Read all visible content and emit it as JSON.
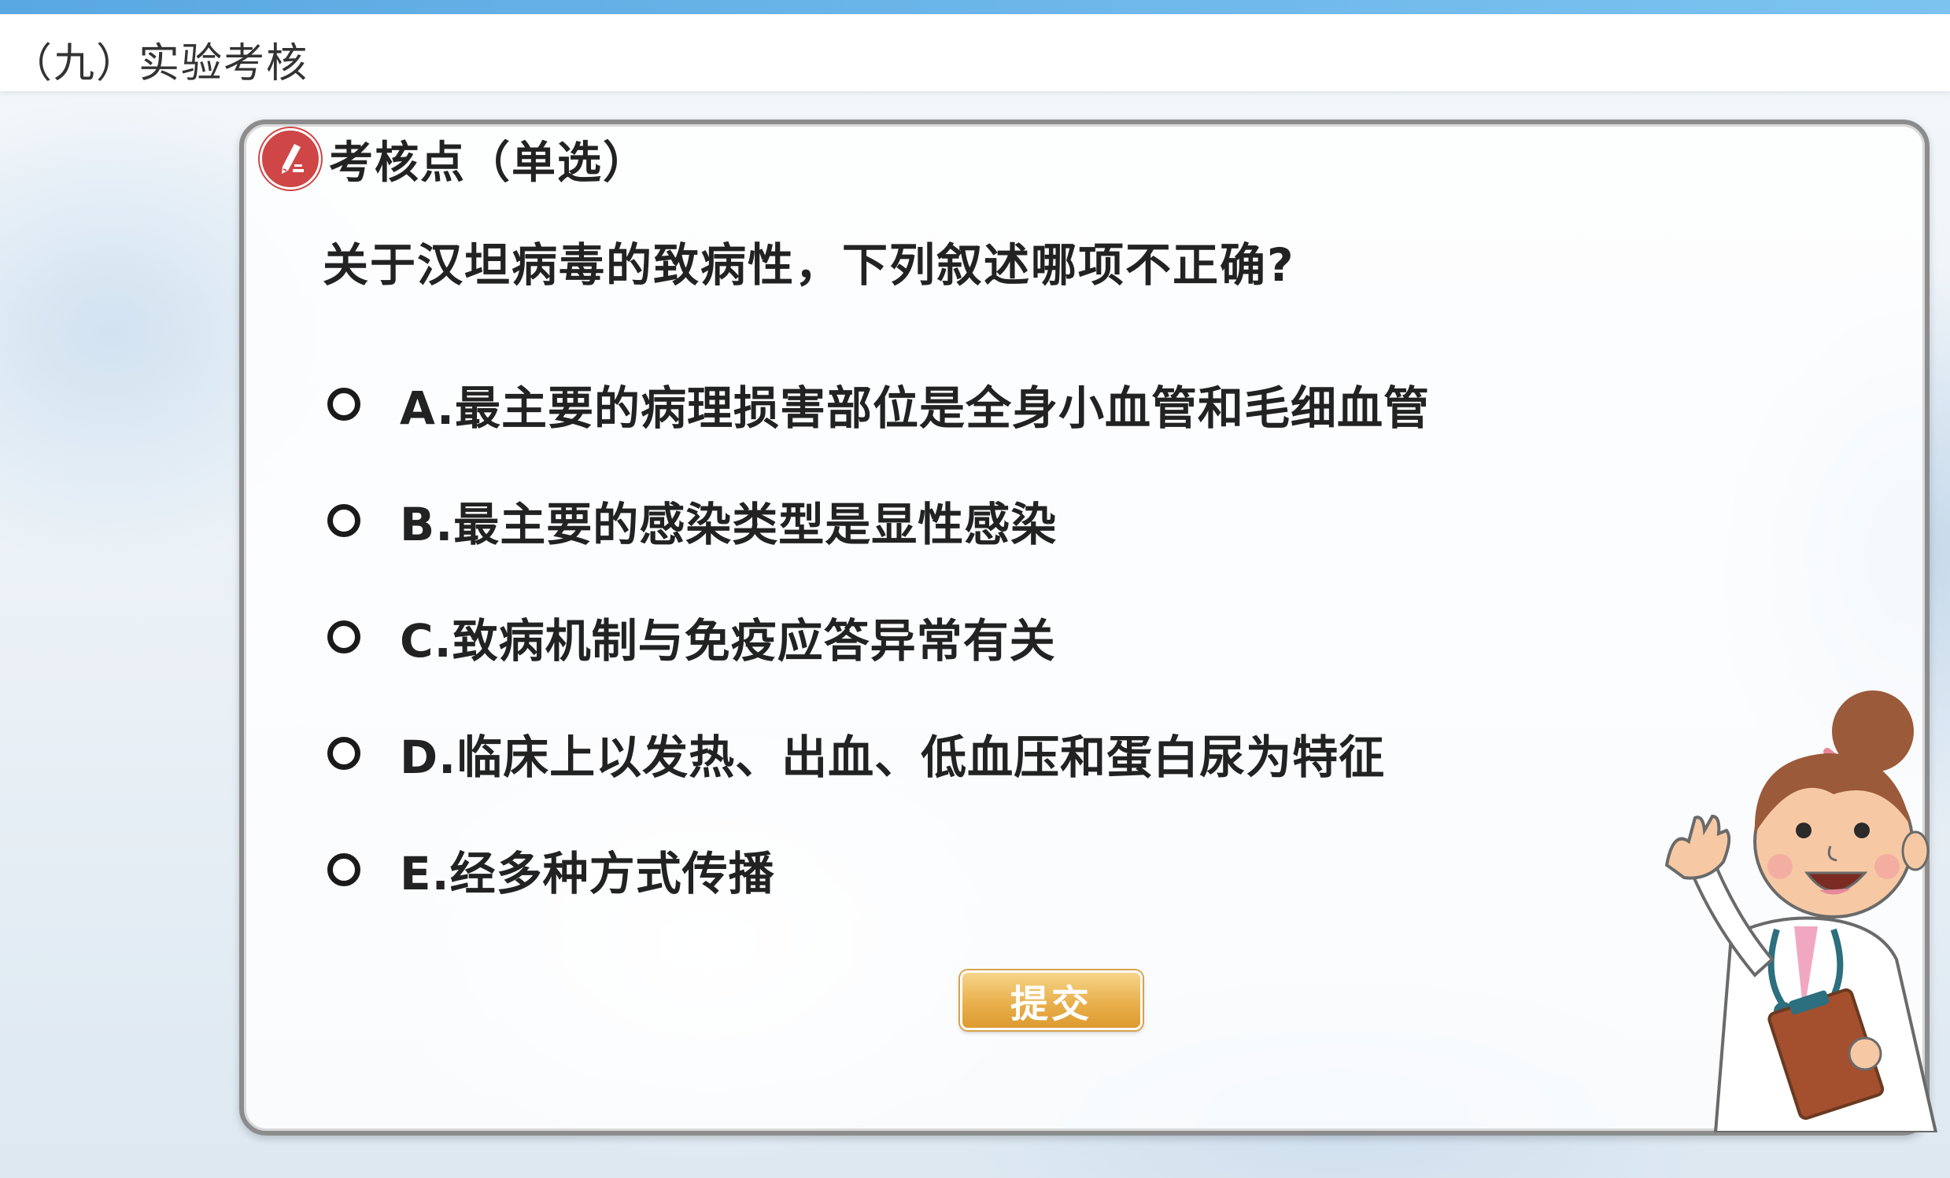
{
  "header": {
    "title": "（九）实验考核"
  },
  "card": {
    "icon": "pen-icon",
    "title": "考核点（单选）",
    "question": "关于汉坦病毒的致病性，下列叙述哪项不正确?"
  },
  "options": [
    {
      "label": "A.最主要的病理损害部位是全身小血管和毛细血管",
      "selected": false
    },
    {
      "label": "B.最主要的感染类型是显性感染",
      "selected": false
    },
    {
      "label": "C.致病机制与免疫应答异常有关",
      "selected": false
    },
    {
      "label": "D.临床上以发热、出血、低血压和蛋白尿为特征",
      "selected": false
    },
    {
      "label": "E.经多种方式传播",
      "selected": false
    }
  ],
  "submit_label": "提交",
  "colors": {
    "accent_bar": "#5aa8e2",
    "pen_badge": "#cf4646",
    "submit": "#e9b04d"
  }
}
